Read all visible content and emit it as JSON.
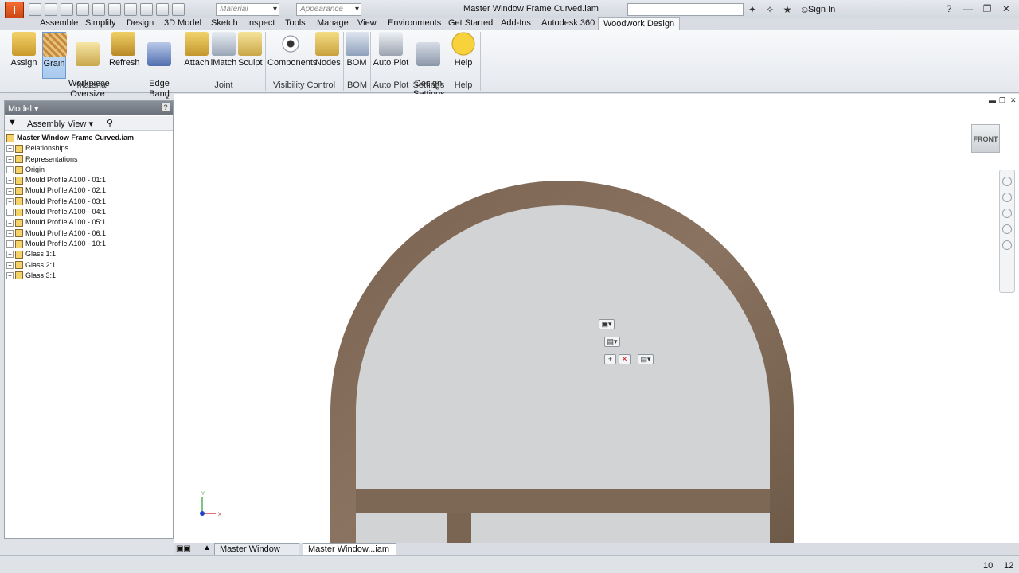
{
  "window": {
    "title": "Master Window Frame Curved.iam",
    "app_logo": "I",
    "material_combo": "Material",
    "appearance_combo": "Appearance",
    "sign_in": "Sign In"
  },
  "menu_tabs": [
    "Assemble",
    "Simplify",
    "Design",
    "3D Model",
    "Sketch",
    "Inspect",
    "Tools",
    "Manage",
    "View",
    "Environments",
    "Get Started",
    "Add-Ins",
    "Autodesk 360",
    "Woodwork Design"
  ],
  "ribbon": {
    "buttons": {
      "assign": "Assign",
      "grain": "Grain",
      "workpiece_oversize": "Workpiece\nOversize",
      "refresh": "Refresh",
      "edge_band_wizard": "Edge Band\nWizard",
      "attach": "Attach",
      "imatch": "iMatch",
      "sculpt": "Sculpt",
      "components": "Components",
      "nodes": "Nodes",
      "bom": "BOM",
      "auto_plot": "Auto Plot",
      "design_settings": "Design\nSettings",
      "help": "Help"
    },
    "groups": {
      "material": "Material",
      "joint": "Joint",
      "visibility_control": "Visibility Control",
      "bom": "BOM",
      "auto_plot": "Auto Plot",
      "settings": "Settings",
      "help": "Help"
    }
  },
  "browser": {
    "header": "Model",
    "help_glyph": "?",
    "view": "Assembly View",
    "tree": [
      {
        "label": "Master Window Frame Curved.iam",
        "root": true
      },
      {
        "label": "Relationships"
      },
      {
        "label": "Representations"
      },
      {
        "label": "Origin"
      },
      {
        "label": "Mould Profile A100 - 01:1"
      },
      {
        "label": "Mould Profile A100 - 02:1"
      },
      {
        "label": "Mould Profile A100 - 03:1"
      },
      {
        "label": "Mould Profile A100 - 04:1"
      },
      {
        "label": "Mould Profile A100 - 05:1"
      },
      {
        "label": "Mould Profile A100 - 06:1"
      },
      {
        "label": "Mould Profile A100 - 10:1"
      },
      {
        "label": "Glass 1:1"
      },
      {
        "label": "Glass 2:1"
      },
      {
        "label": "Glass 3:1"
      }
    ]
  },
  "viewport": {
    "viewcube_label": "FRONT",
    "axis_x": "X",
    "axis_y": "Y"
  },
  "doc_tabs": [
    "Master Window F...ipt",
    "Master Window...iam"
  ],
  "status": {
    "left_num": "10",
    "right_num": "12"
  }
}
